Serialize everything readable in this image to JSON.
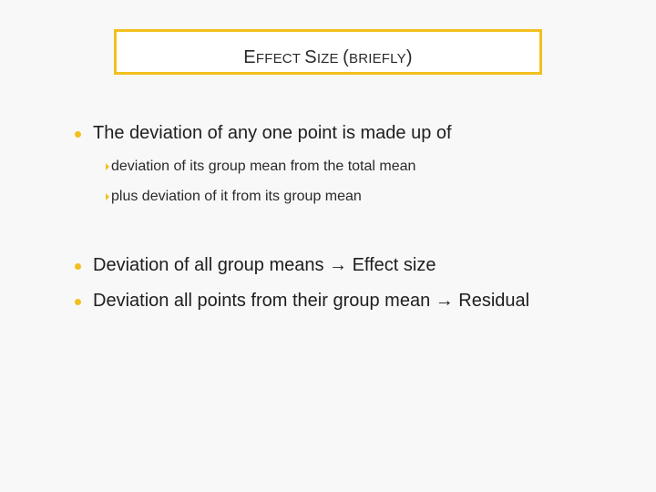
{
  "slide": {
    "title": {
      "parts": [
        {
          "text": "E",
          "small": false
        },
        {
          "text": "FFECT ",
          "small": true
        },
        {
          "text": "S",
          "small": false
        },
        {
          "text": "IZE ",
          "small": true
        },
        {
          "text": "(",
          "small": false
        },
        {
          "text": "BRIEFLY",
          "small": true
        },
        {
          "text": ")",
          "small": false
        }
      ],
      "full": "Effect Size (briefly)"
    },
    "bullets": [
      {
        "text": "The deviation of any one point is made up of",
        "sub": [
          "deviation of its group mean from the total mean",
          "plus deviation of it from its group mean"
        ]
      },
      {
        "text": "Deviation of all group means → Effect size",
        "sub": []
      },
      {
        "text": "Deviation all points from their group mean → Residual",
        "sub": []
      }
    ],
    "accent_color": "#f2c01e"
  }
}
